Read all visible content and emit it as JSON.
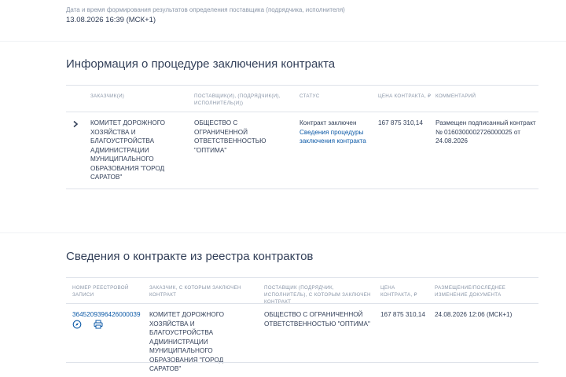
{
  "generation": {
    "label": "Дата и время формирования результатов определения поставщика (подрядчика, исполнителя)",
    "value": "13.08.2026 16:39 (МСК+1)"
  },
  "procedure": {
    "title": "Информация о процедуре заключения контракта",
    "headers": {
      "customer": "Заказчик(и)",
      "supplier": "Поставщик(и), (подрядчик(и), исполнитель(и))",
      "status": "Статус",
      "price": "Цена контракта, ₽",
      "comment": "Комментарий"
    },
    "row": {
      "customer": "КОМИТЕТ ДОРОЖНОГО ХОЗЯЙСТВА И БЛАГОУСТРОЙСТВА АДМИНИСТРАЦИИ МУНИЦИПАЛЬНОГО ОБРАЗОВАНИЯ \"ГОРОД САРАТОВ\"",
      "supplier": "ОБЩЕСТВО С ОГРАНИЧЕННОЙ ОТВЕТСТВЕННОСТЬЮ \"ОПТИМА\"",
      "status": "Контракт заключен",
      "status_link": "Сведения процедуры заключения контракта",
      "price": "167 875 310,14",
      "comment": "Размещен подписанный контракт № 0160300002726000025 от 24.08.2026"
    }
  },
  "registry": {
    "title": "Сведения о контракте из реестра контрактов",
    "headers": {
      "number": "Номер реестровой записи",
      "customer": "Заказчик, с которым заключен контракт",
      "supplier": "Поставщик (подрядчик, исполнитель), с которым заключен контракт",
      "price": "Цена контракта, ₽",
      "placement": "Размещение/последнее изменение документа"
    },
    "row": {
      "number": "3645209396426000039",
      "customer": "КОМИТЕТ ДОРОЖНОГО ХОЗЯЙСТВА И БЛАГОУСТРОЙСТВА АДМИНИСТРАЦИИ МУНИЦИПАЛЬНОГО ОБРАЗОВАНИЯ \"ГОРОД САРАТОВ\"",
      "supplier": "ОБЩЕСТВО С ОГРАНИЧЕННОЙ ОТВЕТСТВЕННОСТЬЮ \"ОПТИМА\"",
      "price": "167 875 310,14",
      "placement": "24.08.2026 12:06 (МСК+1)"
    },
    "icons": [
      "compass-icon",
      "print-icon"
    ]
  },
  "colors": {
    "text": "#334059",
    "muted": "#8a96a8",
    "link": "#0d5aa7",
    "divider": "#dfe3ea",
    "background": "#f0f2f5"
  }
}
